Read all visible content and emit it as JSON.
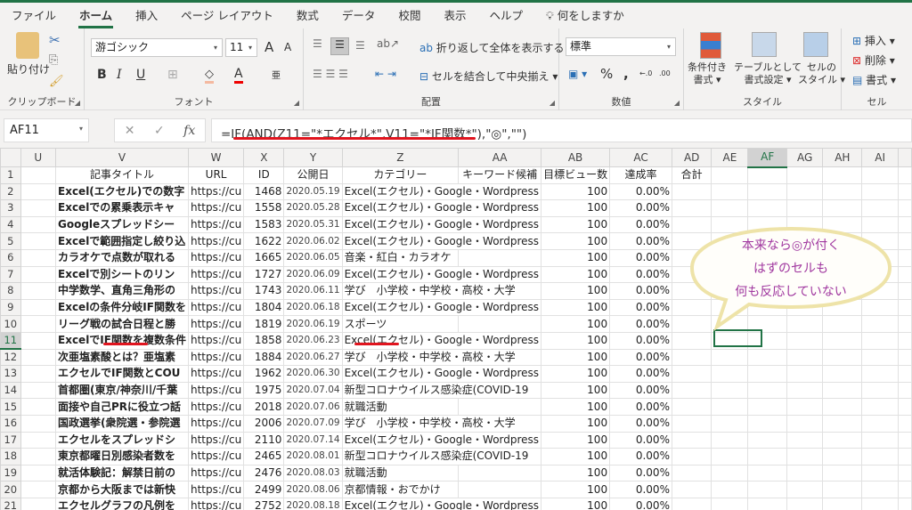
{
  "tabs": [
    "ファイル",
    "ホーム",
    "挿入",
    "ページ レイアウト",
    "数式",
    "データ",
    "校閲",
    "表示",
    "ヘルプ"
  ],
  "tell_me": "何をしますか",
  "ribbon": {
    "clipboard": {
      "paste": "貼り付け",
      "label": "クリップボード"
    },
    "font": {
      "name": "游ゴシック",
      "size": "11",
      "label": "フォント",
      "bold": "B",
      "italic": "I",
      "underline": "U",
      "grow": "A",
      "shrink": "A",
      "color": "A"
    },
    "alignment": {
      "wrap": "折り返して全体を表示する",
      "merge": "セルを結合して中央揃え",
      "label": "配置"
    },
    "number": {
      "format": "標準",
      "percent": "%",
      "comma": ",",
      "inc": "←.0",
      "dec": ".00",
      "label": "数値"
    },
    "styles": {
      "cond": "条件付き",
      "cond2": "書式",
      "table": "テーブルとして",
      "table2": "書式設定",
      "cell": "セルの",
      "cell2": "スタイル",
      "label": "スタイル"
    },
    "cells": {
      "insert": "挿入",
      "delete": "削除",
      "format": "書式",
      "label": "セル"
    }
  },
  "name_box": "AF11",
  "formula": "=IF(AND(Z11=\"*エクセル*\",V11=\"*IF関数*\"),\"◎\",\"\")",
  "columns": [
    "U",
    "V",
    "W",
    "X",
    "Y",
    "Z",
    "AA",
    "AB",
    "AC",
    "AD",
    "AE",
    "AF",
    "AG",
    "AH",
    "AI"
  ],
  "headers": {
    "V": "記事タイトル",
    "W": "URL",
    "X": "ID",
    "Y": "公開日",
    "Z": "カテゴリー",
    "AA": "キーワード候補",
    "AB": "目標ビュー数",
    "AC": "達成率",
    "AD": "合計"
  },
  "rows": [
    {
      "n": "2",
      "V": "Excel(エクセル)での数字",
      "W": "https://cu",
      "X": "1468",
      "Y": "2020.05.19",
      "Z": "Excel(エクセル)・Google・Wordpress",
      "AB": "100",
      "AC": "0.00%"
    },
    {
      "n": "3",
      "V": "Excelでの累乗表示キャ",
      "W": "https://cu",
      "X": "1558",
      "Y": "2020.05.28",
      "Z": "Excel(エクセル)・Google・Wordpress",
      "AB": "100",
      "AC": "0.00%"
    },
    {
      "n": "4",
      "V": "Googleスプレッドシー",
      "W": "https://cu",
      "X": "1583",
      "Y": "2020.05.31",
      "Z": "Excel(エクセル)・Google・Wordpress",
      "AB": "100",
      "AC": "0.00%"
    },
    {
      "n": "5",
      "V": "Excelで範囲指定し絞り込",
      "W": "https://cu",
      "X": "1622",
      "Y": "2020.06.02",
      "Z": "Excel(エクセル)・Google・Wordpress",
      "AB": "100",
      "AC": "0.00%"
    },
    {
      "n": "6",
      "V": "カラオケで点数が取れる",
      "W": "https://cu",
      "X": "1665",
      "Y": "2020.06.05",
      "Z": "音楽・紅白・カラオケ",
      "AB": "100",
      "AC": "0.00%"
    },
    {
      "n": "7",
      "V": "Excelで別シートのリン",
      "W": "https://cu",
      "X": "1727",
      "Y": "2020.06.09",
      "Z": "Excel(エクセル)・Google・Wordpress",
      "AB": "100",
      "AC": "0.00%"
    },
    {
      "n": "8",
      "V": "中学数学、直角三角形の",
      "W": "https://cu",
      "X": "1743",
      "Y": "2020.06.11",
      "Z": "学び　小学校・中学校・高校・大学",
      "AB": "100",
      "AC": "0.00%"
    },
    {
      "n": "9",
      "V": "Excelの条件分岐IF関数を",
      "W": "https://cu",
      "X": "1804",
      "Y": "2020.06.18",
      "Z": "Excel(エクセル)・Google・Wordpress",
      "AB": "100",
      "AC": "0.00%"
    },
    {
      "n": "10",
      "V": "リーグ戦の試合日程と勝",
      "W": "https://cu",
      "X": "1819",
      "Y": "2020.06.19",
      "Z": "スポーツ",
      "AB": "100",
      "AC": "0.00%"
    },
    {
      "n": "11",
      "V": "ExcelでIF関数を複数条件",
      "W": "https://cu",
      "X": "1858",
      "Y": "2020.06.23",
      "Z": "Excel(エクセル)・Google・Wordpress",
      "AB": "100",
      "AC": "0.00%"
    },
    {
      "n": "12",
      "V": "次亜塩素酸とは？亜塩素",
      "W": "https://cu",
      "X": "1884",
      "Y": "2020.06.27",
      "Z": "学び　小学校・中学校・高校・大学",
      "AB": "100",
      "AC": "0.00%"
    },
    {
      "n": "13",
      "V": "エクセルでIF関数とCOU",
      "W": "https://cu",
      "X": "1962",
      "Y": "2020.06.30",
      "Z": "Excel(エクセル)・Google・Wordpress",
      "AB": "100",
      "AC": "0.00%"
    },
    {
      "n": "14",
      "V": "首都圏(東京/神奈川/千葉",
      "W": "https://cu",
      "X": "1975",
      "Y": "2020.07.04",
      "Z": "新型コロナウイルス感染症(COVID-19",
      "AB": "100",
      "AC": "0.00%"
    },
    {
      "n": "15",
      "V": "面接や自己PRに役立つ話",
      "W": "https://cu",
      "X": "2018",
      "Y": "2020.07.06",
      "Z": "就職活動",
      "AB": "100",
      "AC": "0.00%"
    },
    {
      "n": "16",
      "V": "国政選挙(衆院選・参院選",
      "W": "https://cu",
      "X": "2006",
      "Y": "2020.07.09",
      "Z": "学び　小学校・中学校・高校・大学",
      "AB": "100",
      "AC": "0.00%"
    },
    {
      "n": "17",
      "V": "エクセルをスプレッドシ",
      "W": "https://cu",
      "X": "2110",
      "Y": "2020.07.14",
      "Z": "Excel(エクセル)・Google・Wordpress",
      "AB": "100",
      "AC": "0.00%"
    },
    {
      "n": "18",
      "V": "東京都曜日別感染者数を",
      "W": "https://cu",
      "X": "2465",
      "Y": "2020.08.01",
      "Z": "新型コロナウイルス感染症(COVID-19",
      "AB": "100",
      "AC": "0.00%"
    },
    {
      "n": "19",
      "V": "就活体験記：解禁日前の",
      "W": "https://cu",
      "X": "2476",
      "Y": "2020.08.03",
      "Z": "就職活動",
      "AB": "100",
      "AC": "0.00%"
    },
    {
      "n": "20",
      "V": "京都から大阪までは新快",
      "W": "https://cu",
      "X": "2499",
      "Y": "2020.08.06",
      "Z": "京都情報・おでかけ",
      "AB": "100",
      "AC": "0.00%"
    },
    {
      "n": "21",
      "V": "エクセルグラフの凡例を",
      "W": "https://cu",
      "X": "2752",
      "Y": "2020.08.18",
      "Z": "Excel(エクセル)・Google・Wordpress",
      "AB": "100",
      "AC": "0.00%"
    }
  ],
  "callout": {
    "line1": "本来なら◎が付く",
    "line2": "はずのセルも",
    "line3": "何も反応していない"
  },
  "colors": {
    "accent": "#217346",
    "underline": "#e0141e",
    "callout_text": "#a0379f"
  }
}
